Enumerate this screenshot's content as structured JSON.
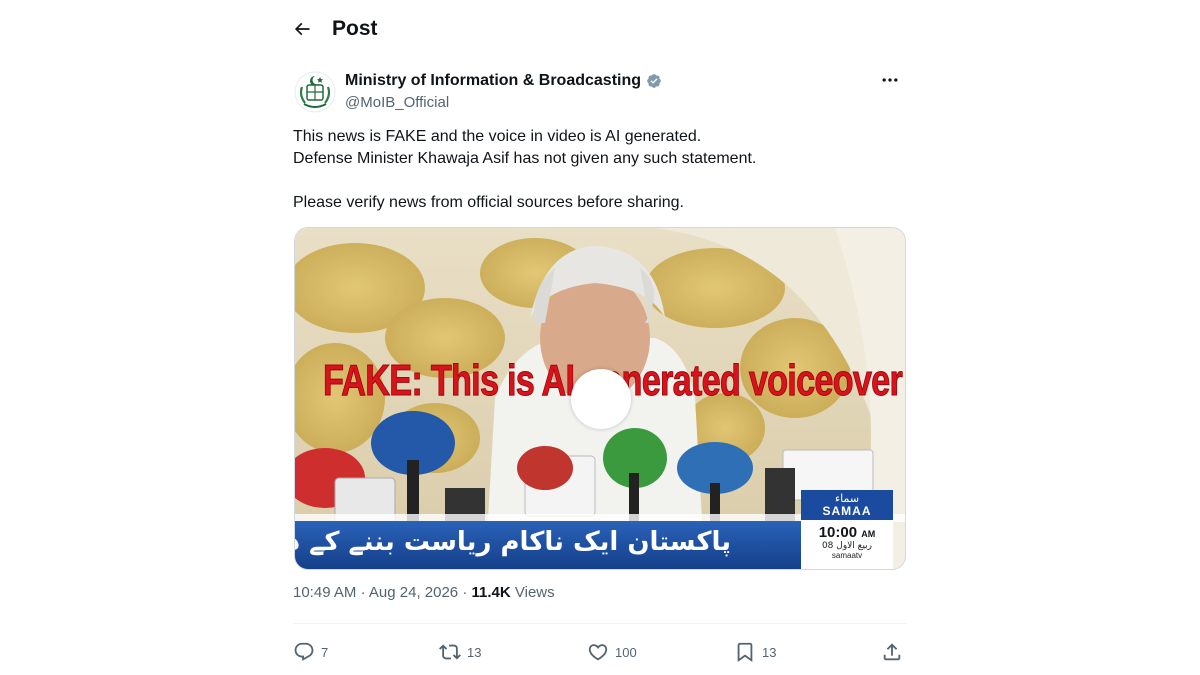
{
  "header": {
    "title": "Post"
  },
  "author": {
    "name": "Ministry of Information & Broadcasting",
    "handle": "@MoIB_Official",
    "verified_color": "#829aab"
  },
  "tweet": {
    "line1": "This news is FAKE and the voice in video is AI generated.",
    "line2": "Defense Minister Khawaja Asif has not given any such statement.",
    "line3": "Please verify news from official sources before sharing."
  },
  "media": {
    "overlay_text": "FAKE: This is AI generated voiceover  !!",
    "ticker_text": "پاکستان ایک ناکام ریاست بننے کے دہانے پر کھڑا ہے۔",
    "channel_urdu": "سماء",
    "channel_name": "SAMAA",
    "time": "10:00",
    "time_suffix": "AM",
    "date": "08 ربیع الاول",
    "website": "samaatv"
  },
  "meta": {
    "time": "10:49 AM",
    "separator": "·",
    "date": "Aug 24, 2026",
    "views_count": "11.4K",
    "views_label": "Views"
  },
  "actions": {
    "replies": "7",
    "reposts": "13",
    "likes": "100",
    "bookmarks": "13"
  },
  "colors": {
    "text": "#0f1419",
    "secondary": "#536471",
    "overlay_red": "#d6141c",
    "ticker_blue": "#1b4b9e"
  }
}
